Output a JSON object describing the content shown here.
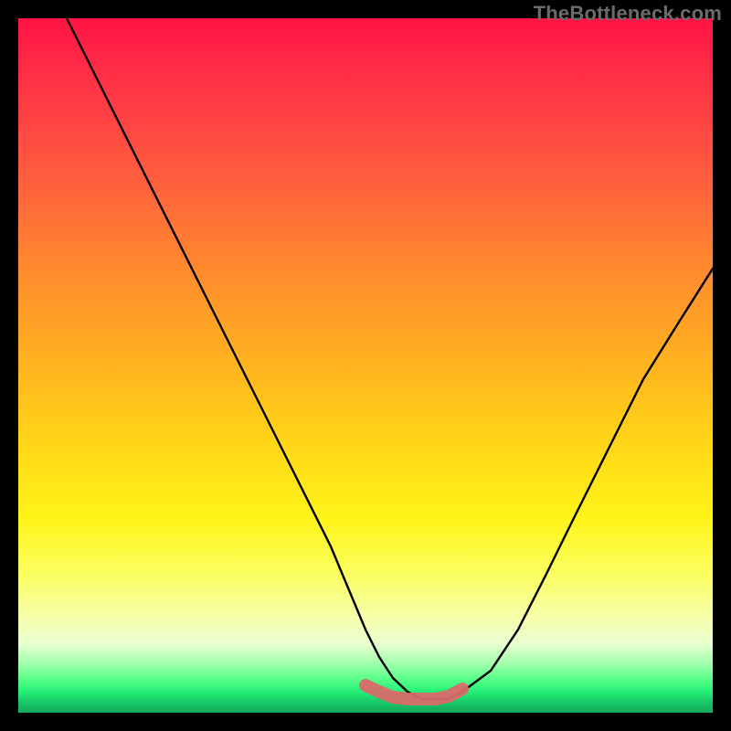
{
  "watermark": "TheBottleneck.com",
  "chart_data": {
    "type": "line",
    "title": "",
    "xlabel": "",
    "ylabel": "",
    "xlim": [
      0,
      100
    ],
    "ylim": [
      0,
      100
    ],
    "grid": false,
    "legend": false,
    "annotations": [],
    "series": [
      {
        "name": "curve",
        "color": "#000000",
        "x": [
          7,
          10,
          15,
          20,
          25,
          30,
          35,
          40,
          45,
          50,
          52,
          54,
          56,
          58,
          60,
          62,
          64,
          68,
          72,
          76,
          80,
          85,
          90,
          95,
          100
        ],
        "y": [
          100,
          94,
          84,
          74,
          64,
          54,
          44,
          34,
          24,
          12,
          8,
          5,
          3,
          2,
          2,
          2,
          3,
          6,
          12,
          20,
          28,
          38,
          48,
          56,
          64
        ]
      },
      {
        "name": "bottom-highlight",
        "color": "#d96a6a",
        "x": [
          50,
          52,
          54,
          56,
          58,
          60,
          62,
          64
        ],
        "y": [
          4,
          3,
          2.2,
          2,
          2,
          2,
          2.4,
          3.4
        ]
      }
    ]
  }
}
